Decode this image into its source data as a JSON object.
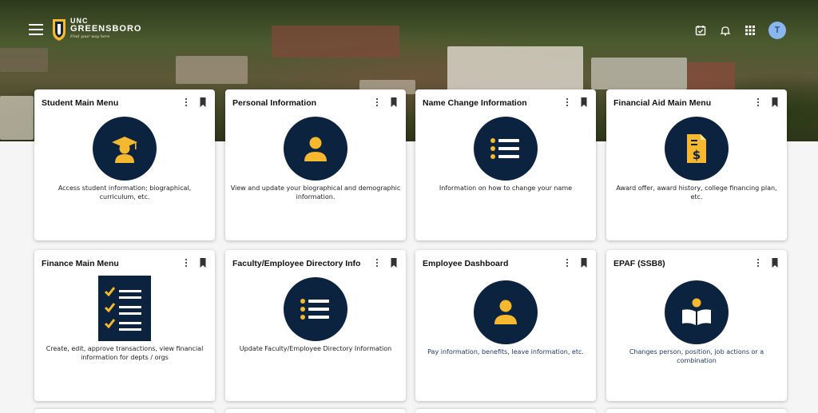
{
  "header": {
    "brand_line1": "UNC",
    "brand_line2": "GREENSBORO",
    "brand_tagline": "Find your way here",
    "avatar_initial": "T"
  },
  "colors": {
    "navy": "#0c2340",
    "gold": "#f5b82e",
    "avatar": "#8ab6f0"
  },
  "cards": [
    {
      "title": "Student Main Menu",
      "description": "Access student information; biographical, curriculum, etc.",
      "icon": "graduate-icon"
    },
    {
      "title": "Personal Information",
      "description": "View and update your biographical and demographic information.",
      "icon": "person-icon"
    },
    {
      "title": "Name Change Information",
      "description": "Information on how to change your name",
      "icon": "list-icon"
    },
    {
      "title": "Financial Aid Main Menu",
      "description": "Award offer, award history, college financing plan, etc.",
      "icon": "dollar-document-icon"
    },
    {
      "title": "Finance Main Menu",
      "description": "Create, edit, approve transactions, view financial information for depts / orgs",
      "icon": "checklist-icon"
    },
    {
      "title": "Faculty/Employee Directory Info",
      "description": "Update Faculty/Employee Directory Information",
      "icon": "list-icon"
    },
    {
      "title": "Employee Dashboard",
      "description": "Pay information, benefits, leave information, etc.",
      "icon": "person-icon"
    },
    {
      "title": "EPAF (SSB8)",
      "description": "Changes person, position, job actions or a combination",
      "icon": "reader-icon"
    }
  ]
}
